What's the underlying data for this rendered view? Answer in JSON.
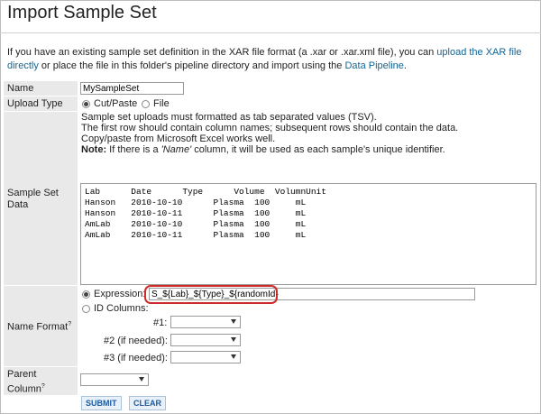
{
  "page": {
    "title": "Import Sample Set",
    "intro_pre": "If you have an existing sample set definition in the XAR file format (a .xar or .xar.xml file), you can ",
    "intro_link1": "upload the XAR file directly",
    "intro_mid": " or place the file in this folder's pipeline directory and import using the ",
    "intro_link2": "Data Pipeline",
    "intro_post": "."
  },
  "form": {
    "name_label": "Name",
    "name_value": "MySampleSet",
    "upload_type_label": "Upload Type",
    "upload_options": [
      "Cut/Paste",
      "File"
    ],
    "upload_selected": "Cut/Paste",
    "sample_set_data_label": "Sample Set Data",
    "help_line1": "Sample set uploads must formatted as tab separated values (TSV).",
    "help_line2": "The first row should contain column names; subsequent rows should contain the data.",
    "help_line3": "Copy/paste from Microsoft Excel works well.",
    "note_label": "Note:",
    "note_pre": " If there is a ",
    "note_em": "'Name'",
    "note_post": " column, it will be used as each sample's unique identifier.",
    "data_text": "Lab      Date      Type      Volume  VolumnUnit\nHanson   2010-10-10      Plasma  100     mL\nHanson   2010-10-11      Plasma  100     mL\nAmLab    2010-10-10      Plasma  100     mL\nAmLab    2010-10-11      Plasma  100     mL",
    "name_format_label": "Name Format",
    "expression_label": "Expression:",
    "expression_value": "S_${Lab}_${Type}_${randomId}",
    "id_columns_label": "ID Columns:",
    "id1_label": "#1:",
    "id2_label": "#2 (if needed):",
    "id3_label": "#3 (if needed):",
    "parent_column_label_1": "Parent",
    "parent_column_label_2": "Column",
    "help_mark": "?",
    "submit_label": "SUBMIT",
    "clear_label": "CLEAR"
  },
  "colors": {
    "link": "#126495",
    "highlight": "#d12a2a",
    "label_bg": "#e9e9e9"
  }
}
